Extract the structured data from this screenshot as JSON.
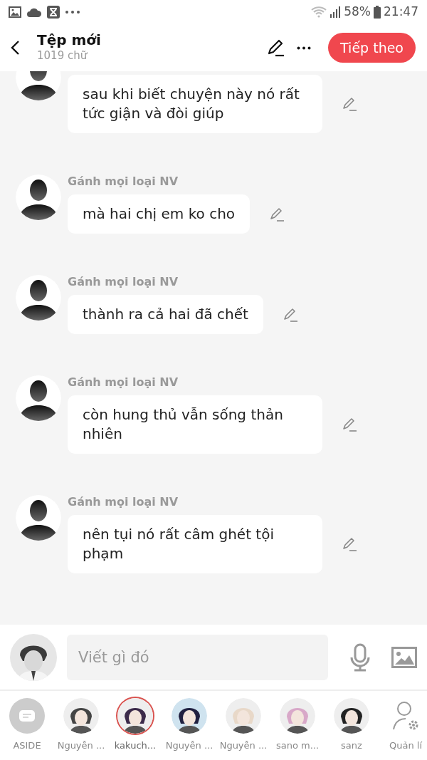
{
  "status_bar": {
    "battery": "58%",
    "time": "21:47"
  },
  "header": {
    "title": "Tệp mới",
    "subtitle": "1019 chữ",
    "next_button": "Tiếp theo"
  },
  "messages": [
    {
      "text": "sau khi biết chuyện này nó rất tức giận và đòi giúp"
    },
    {
      "name": "Gánh mọi loại NV",
      "text": "mà hai chị em ko cho"
    },
    {
      "name": "Gánh mọi loại NV",
      "text": "thành ra cả hai đã chết"
    },
    {
      "name": "Gánh mọi loại NV",
      "text": "còn hung thủ vẫn sống thản nhiên"
    },
    {
      "name": "Gánh mọi loại NV",
      "text": "nên tụi nó rất câm ghét tội phạm"
    }
  ],
  "composer": {
    "placeholder": "Viết gì đó"
  },
  "characters": [
    {
      "kind": "aside",
      "label": "ASIDE",
      "selected": false
    },
    {
      "kind": "picture",
      "label": "Nguyễn ...",
      "selected": false
    },
    {
      "kind": "picture",
      "label": "kakuch...",
      "selected": true
    },
    {
      "kind": "picture",
      "label": "Nguyễn ...",
      "selected": false
    },
    {
      "kind": "picture",
      "label": "Nguyễn ...",
      "selected": false
    },
    {
      "kind": "picture",
      "label": "sano m...",
      "selected": false
    },
    {
      "kind": "picture",
      "label": "sanz",
      "selected": false
    },
    {
      "kind": "manage",
      "label": "Quản lí",
      "selected": false
    }
  ]
}
